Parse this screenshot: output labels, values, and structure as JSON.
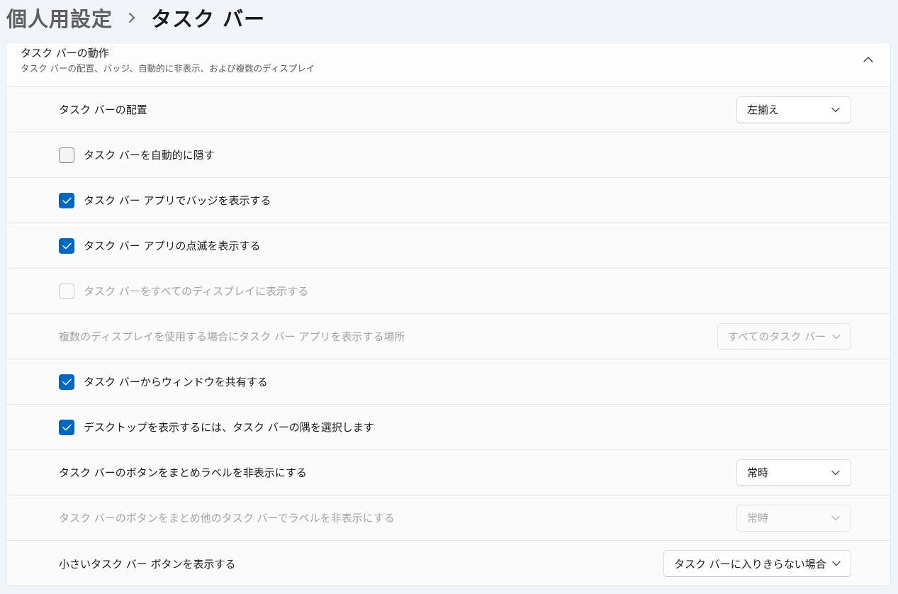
{
  "breadcrumb": {
    "parent": "個人用設定",
    "separator": "›",
    "current": "タスク バー"
  },
  "section": {
    "title": "タスク バーの動作",
    "subtitle": "タスク バーの配置、バッジ、自動的に非表示、および複数のディスプレイ",
    "expanded": true
  },
  "rows": {
    "alignment": {
      "label": "タスク バーの配置",
      "value": "左揃え"
    },
    "auto_hide": {
      "label": "タスク バーを自動的に隠す",
      "checked": false
    },
    "badges": {
      "label": "タスク バー アプリでバッジを表示する",
      "checked": true
    },
    "flashing": {
      "label": "タスク バー アプリの点滅を表示する",
      "checked": true
    },
    "all_displays": {
      "label": "タスク バーをすべてのディスプレイに表示する",
      "checked": false,
      "disabled": true
    },
    "multi_display_apps": {
      "label": "複数のディスプレイを使用する場合にタスク バー アプリを表示する場所",
      "value": "すべてのタスク バー",
      "disabled": true
    },
    "share_window": {
      "label": "タスク バーからウィンドウを共有する",
      "checked": true
    },
    "show_desktop": {
      "label": "デスクトップを表示するには、タスク バーの隅を選択します",
      "checked": true
    },
    "combine_buttons": {
      "label": "タスク バーのボタンをまとめラベルを非表示にする",
      "value": "常時"
    },
    "combine_other": {
      "label": "タスク バーのボタンをまとめ他のタスク バーでラベルを非表示にする",
      "value": "常時",
      "disabled": true
    },
    "small_buttons": {
      "label": "小さいタスク バー ボタンを表示する",
      "value": "タスク バーに入りきらない場合"
    }
  },
  "colors": {
    "accent": "#0067c0",
    "background": "#f1f4f9",
    "card": "#fbfbfc",
    "disabled_text": "#a2a2a2"
  },
  "icons": {
    "collapse": "chevron-up-icon",
    "dropdown": "chevron-down-icon",
    "check": "checkmark-icon",
    "breadcrumb_separator": "chevron-right-icon"
  }
}
